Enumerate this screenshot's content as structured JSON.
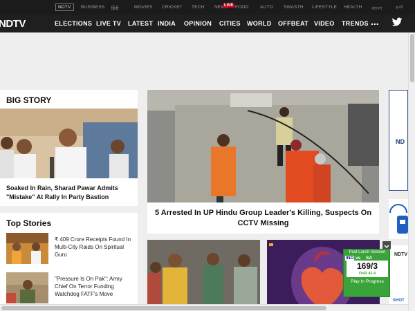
{
  "topbar": {
    "items": [
      "NDTV",
      "BUSINESS",
      "हिंदी",
      "MOVIES",
      "CRICKET",
      "TECH",
      "NEWS",
      "FOOD",
      "AUTO",
      "SWASTH",
      "LIFESTYLE",
      "HEALTH",
      "বাংলা",
      "தமி"
    ],
    "live_badge": "LIVE"
  },
  "nav": {
    "logo": "NDTV",
    "links": [
      "ELECTIONS",
      "LIVE TV",
      "LATEST",
      "INDIA",
      "OPINION",
      "CITIES",
      "WORLD",
      "OFFBEAT",
      "VIDEO",
      "TRENDS"
    ],
    "more": "..."
  },
  "big_story": {
    "title": "BIG STORY",
    "caption": "Soaked In Rain, Sharad Pawar Admits \"Mistake\" At Rally In Party Bastion"
  },
  "top_stories": {
    "title": "Top Stories",
    "items": [
      {
        "text": "₹ 409 Crore Receipts Found In Multi-City Raids On Spiritual Guru"
      },
      {
        "text": "\"Pressure Is On Pak\": Army Chief On Terror Funding Watchdog FATF's Move"
      }
    ]
  },
  "hero": {
    "caption": "5 Arrested In UP Hindu Group Leader's Killing, Suspects On CCTV Missing"
  },
  "rail": {
    "ad_text": "ND",
    "ndtv_label": "NDTV",
    "shot_label": "SHOT"
  },
  "cricket": {
    "status": "Post Lunch Session",
    "team_a": "IND",
    "vs": "vs",
    "team_b": "SA",
    "score": "169/3",
    "overs": "OVR 42.4",
    "play": "Play In Progress"
  },
  "colors": {
    "nav_bg": "#1f1f1f",
    "live_red": "#d0021b",
    "cricket_green": "#3aa43a"
  }
}
